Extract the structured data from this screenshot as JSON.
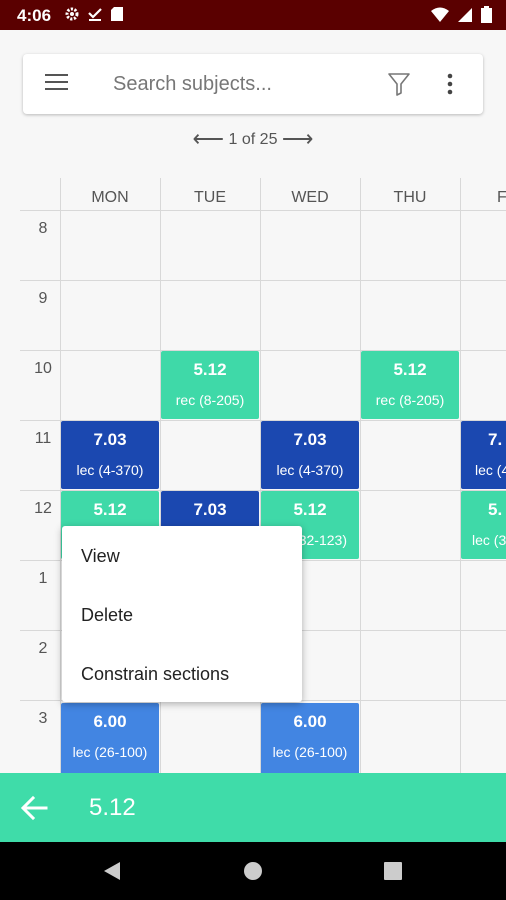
{
  "status_bar": {
    "time": "4:06"
  },
  "search": {
    "placeholder": "Search subjects..."
  },
  "pager": {
    "prev_arrow": "⟵",
    "text": "1 of 25",
    "next_arrow": "⟶"
  },
  "days": [
    "MON",
    "TUE",
    "WED",
    "THU",
    "F"
  ],
  "hours": [
    "8",
    "9",
    "10",
    "11",
    "12",
    "1",
    "2",
    "3"
  ],
  "blocks": [
    {
      "subject": "5.12",
      "detail": "rec (8-205)"
    },
    {
      "subject": "5.12",
      "detail": "rec (8-205)"
    },
    {
      "subject": "7.03",
      "detail": "lec (4-370)"
    },
    {
      "subject": "7.03",
      "detail": "lec (4-370)"
    },
    {
      "subject": "7.",
      "detail": "lec (4"
    },
    {
      "subject": "5.12",
      "detail": ""
    },
    {
      "subject": "7.03",
      "detail": ""
    },
    {
      "subject": "5.12",
      "detail": "32-123)"
    },
    {
      "subject": "5.",
      "detail": "lec (3"
    },
    {
      "subject": "6.00",
      "detail": "lec (26-100)"
    },
    {
      "subject": "6.00",
      "detail": "lec (26-100)"
    }
  ],
  "context_menu": {
    "items": [
      "View",
      "Delete",
      "Constrain sections"
    ]
  },
  "bottom_bar": {
    "title": "5.12"
  },
  "colors": {
    "status_bar": "#5a0000",
    "green": "#3fd9a8",
    "navy": "#1b48b0",
    "blue": "#4285e2"
  }
}
